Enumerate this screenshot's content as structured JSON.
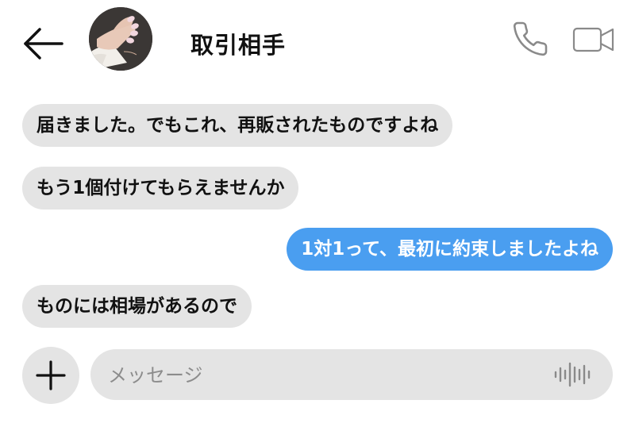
{
  "header": {
    "title": "取引相手",
    "back_icon": "arrow-left-icon",
    "call_icon": "phone-icon",
    "video_icon": "video-camera-icon"
  },
  "messages": [
    {
      "side": "incoming",
      "text": "届きました。でもこれ、再販されたものですよね"
    },
    {
      "side": "incoming",
      "text": "もう1個付けてもらえませんか"
    },
    {
      "side": "outgoing",
      "text": "1対1って、最初に約束しましたよね"
    },
    {
      "side": "incoming",
      "text": "ものには相場があるので"
    }
  ],
  "composer": {
    "placeholder": "メッセージ",
    "value": "",
    "add_icon": "plus-icon",
    "voice_icon": "audio-waveform-icon"
  },
  "colors": {
    "incoming_bubble": "#e4e4e4",
    "outgoing_bubble": "#4a9ef0",
    "text": "#111111",
    "icon_gray": "#8a8a8a"
  }
}
